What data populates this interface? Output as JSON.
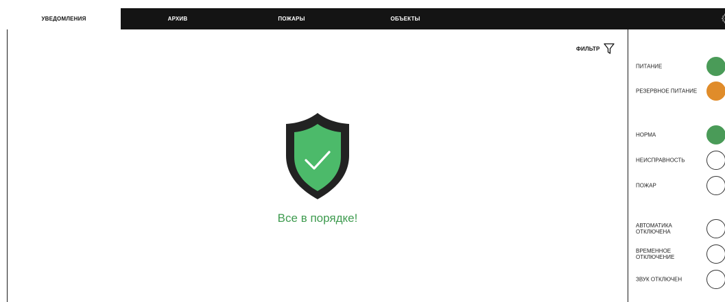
{
  "tabs": [
    {
      "label": "УВЕДОМЛЕНИЯ",
      "active": true
    },
    {
      "label": "АРХИВ",
      "active": false
    },
    {
      "label": "ПОЖАРЫ",
      "active": false
    },
    {
      "label": "ОБЪЕКТЫ",
      "active": false
    }
  ],
  "header": {
    "settings_icon": "gear-icon"
  },
  "main": {
    "filter_label": "ФИЛЬТР",
    "filter_icon": "filter-funnel-icon",
    "status_icon": "shield-check-icon",
    "status_message": "Все в порядке!"
  },
  "indicators": [
    {
      "label": "ПИТАНИЕ",
      "state": "on",
      "color": "#4a9b58"
    },
    {
      "label": "РЕЗЕРВНОЕ ПИТАНИЕ",
      "state": "on",
      "color": "#e08c2a"
    },
    {
      "label": "НОРМА",
      "state": "on",
      "color": "#4a9b58"
    },
    {
      "label": "НЕИСПРАВНОСТЬ",
      "state": "off",
      "color": "#ffffff"
    },
    {
      "label": "ПОЖАР",
      "state": "off",
      "color": "#ffffff"
    },
    {
      "label": "АВТОМАТИКА ОТКЛЮЧЕНА",
      "state": "off",
      "color": "#ffffff"
    },
    {
      "label": "ВРЕМЕННОЕ ОТКЛЮЧЕНИЕ",
      "state": "off",
      "color": "#ffffff"
    },
    {
      "label": "ЗВУК ОТКЛЮЧЕН",
      "state": "off",
      "color": "#ffffff"
    }
  ],
  "colors": {
    "tabbar_bg": "#141414",
    "ok_green": "#3e9b4f",
    "shield_dark": "#222222",
    "shield_green": "#4cba6a",
    "backup_orange": "#e08c2a"
  }
}
